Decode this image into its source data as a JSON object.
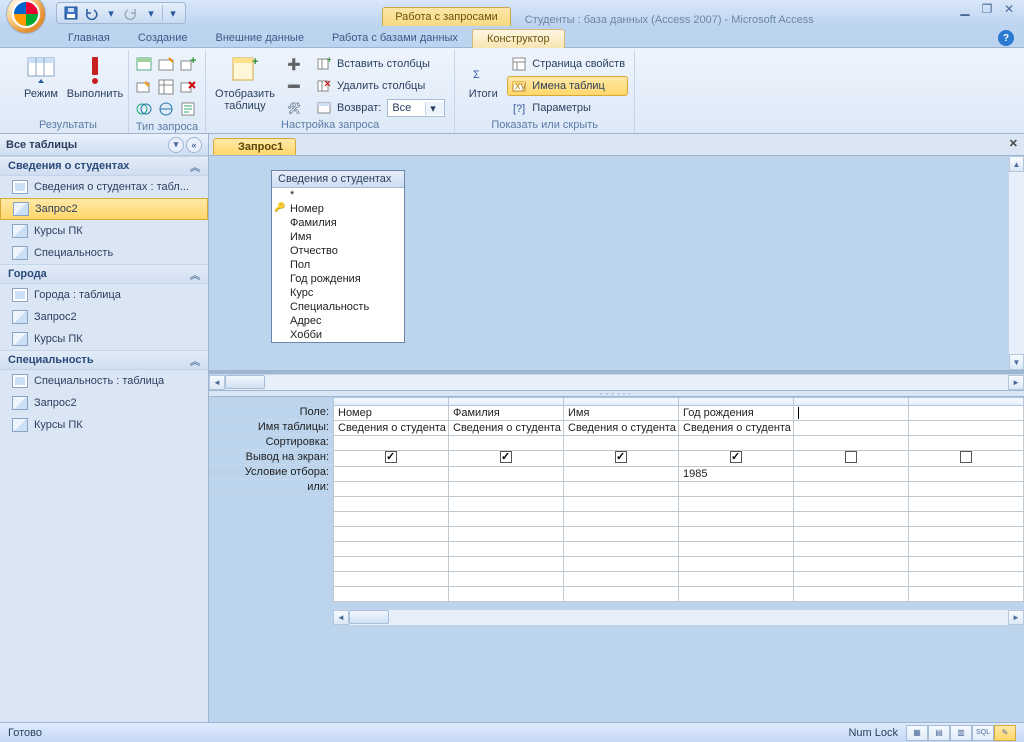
{
  "window": {
    "context_tab": "Работа с запросами",
    "title": "Студенты : база данных (Access 2007) - Microsoft Access"
  },
  "ribbon_tabs": {
    "home": "Главная",
    "create": "Создание",
    "external": "Внешние данные",
    "dbtools": "Работа с базами данных",
    "design": "Конструктор"
  },
  "ribbon": {
    "group_results": "Результаты",
    "group_qtype": "Тип запроса",
    "group_setup": "Настройка запроса",
    "group_showhide": "Показать или скрыть",
    "view": "Режим",
    "run": "Выполнить",
    "show_table": "Отобразить таблицу",
    "insert_cols": "Вставить столбцы",
    "delete_cols": "Удалить столбцы",
    "return_lbl": "Возврат:",
    "return_val": "Все",
    "totals": "Итоги",
    "prop_sheet": "Страница свойств",
    "table_names": "Имена таблиц",
    "parameters": "Параметры"
  },
  "nav": {
    "header": "Все таблицы",
    "g1": "Сведения о студентах",
    "g1_items": {
      "a": "Сведения о студентах : табл...",
      "b": "Запрос2",
      "c": "Курсы ПК",
      "d": "Специальность"
    },
    "g2": "Города",
    "g2_items": {
      "a": "Города : таблица",
      "b": "Запрос2",
      "c": "Курсы ПК"
    },
    "g3": "Специальность",
    "g3_items": {
      "a": "Специальность : таблица",
      "b": "Запрос2",
      "c": "Курсы ПК"
    }
  },
  "object_tab": "Запрос1",
  "table_box": {
    "title": "Сведения о студентах",
    "fields": {
      "star": "*",
      "f0": "Номер",
      "f1": "Фамилия",
      "f2": "Имя",
      "f3": "Отчество",
      "f4": "Пол",
      "f5": "Год рождения",
      "f6": "Курс",
      "f7": "Специальность",
      "f8": "Адрес",
      "f9": "Хобби"
    }
  },
  "grid_rows": {
    "field": "Поле:",
    "table": "Имя таблицы:",
    "sort": "Сортировка:",
    "show": "Вывод на экран:",
    "criteria": "Условие отбора:",
    "or": "или:"
  },
  "grid_cols": {
    "c0": {
      "field": "Номер",
      "table": "Сведения о студента",
      "show": true,
      "criteria": ""
    },
    "c1": {
      "field": "Фамилия",
      "table": "Сведения о студента",
      "show": true,
      "criteria": ""
    },
    "c2": {
      "field": "Имя",
      "table": "Сведения о студента",
      "show": true,
      "criteria": ""
    },
    "c3": {
      "field": "Год рождения",
      "table": "Сведения о студента",
      "show": true,
      "criteria": "1985"
    },
    "c4": {
      "field": "",
      "table": "",
      "show": false,
      "criteria": ""
    },
    "c5": {
      "field": "",
      "table": "",
      "show": false,
      "criteria": ""
    }
  },
  "status": {
    "ready": "Готово",
    "numlock": "Num Lock"
  }
}
